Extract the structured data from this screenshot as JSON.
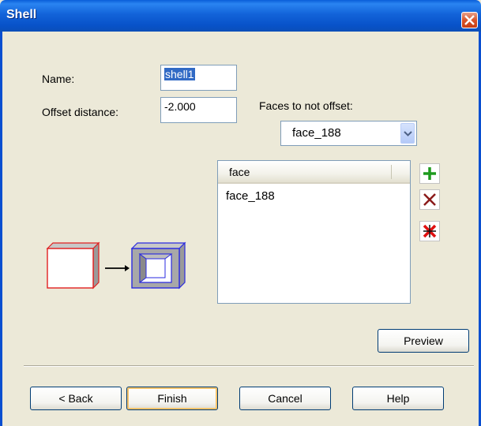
{
  "window": {
    "title": "Shell"
  },
  "form": {
    "name_label": "Name:",
    "name_value_selected": "shell1",
    "offset_label": "Offset distance:",
    "offset_value": "-2.000",
    "faces_label": "Faces to not offset:",
    "faces_combo_value": "face_188"
  },
  "face_list": {
    "column_header": "face",
    "rows": [
      "face_188"
    ]
  },
  "side_tools": {
    "add_icon": "plus-icon",
    "remove_icon": "x-icon",
    "clear_icon": "x-star-icon"
  },
  "buttons": {
    "preview": "Preview",
    "back": "< Back",
    "finish": "Finish",
    "cancel": "Cancel",
    "help": "Help"
  },
  "colors": {
    "titlebar": "#0a5ed8",
    "dialog_bg": "#ece9d8",
    "add_green": "#1e9a1e",
    "remove_red": "#8b1a1a",
    "clear_red": "#e01010"
  }
}
